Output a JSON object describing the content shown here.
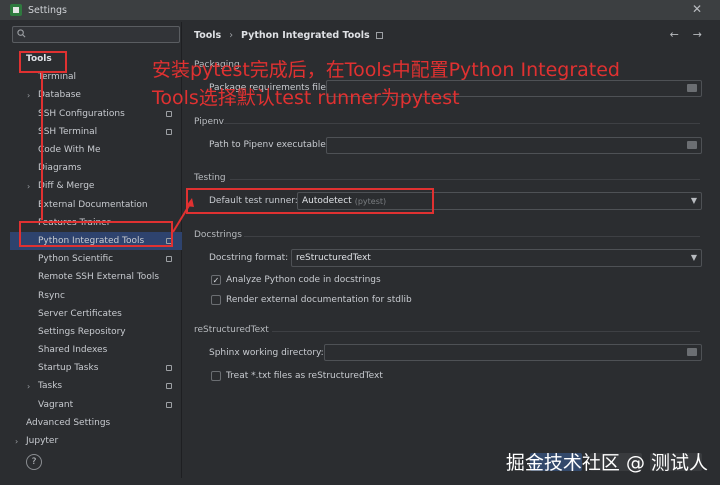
{
  "window": {
    "title": "Settings"
  },
  "search": {
    "placeholder": "Q"
  },
  "sidebar": {
    "items": [
      {
        "label": "Tools",
        "bold": true
      },
      {
        "label": "Terminal"
      },
      {
        "label": "Database",
        "expandable": true
      },
      {
        "label": "SSH Configurations",
        "configurable": true
      },
      {
        "label": "SSH Terminal",
        "configurable": true
      },
      {
        "label": "Code With Me"
      },
      {
        "label": "Diagrams"
      },
      {
        "label": "Diff & Merge",
        "expandable": true
      },
      {
        "label": "External Documentation"
      },
      {
        "label": "Features Trainer"
      },
      {
        "label": "Python Integrated Tools",
        "configurable": true,
        "selected": true
      },
      {
        "label": "Python Scientific",
        "configurable": true
      },
      {
        "label": "Remote SSH External Tools"
      },
      {
        "label": "Rsync"
      },
      {
        "label": "Server Certificates"
      },
      {
        "label": "Settings Repository"
      },
      {
        "label": "Shared Indexes"
      },
      {
        "label": "Startup Tasks",
        "configurable": true
      },
      {
        "label": "Tasks",
        "expandable": true,
        "configurable": true
      },
      {
        "label": "Vagrant",
        "configurable": true
      },
      {
        "label": "Advanced Settings"
      },
      {
        "label": "Jupyter",
        "expandable": true
      }
    ]
  },
  "breadcrumb": {
    "root": "Tools",
    "current": "Python Integrated Tools"
  },
  "packaging": {
    "title": "Packaging",
    "requirements_label": "Package requirements file:",
    "requirements_value": ""
  },
  "pipenv": {
    "title": "Pipenv",
    "path_label": "Path to Pipenv executable:",
    "path_value": ""
  },
  "testing": {
    "title": "Testing",
    "runner_label": "Default test runner:",
    "runner_value": "Autodetect",
    "runner_hint": "(pytest)"
  },
  "docstrings": {
    "title": "Docstrings",
    "format_label": "Docstring format:",
    "format_value": "reStructuredText",
    "analyze_label": "Analyze Python code in docstrings",
    "analyze_checked": true,
    "render_label": "Render external documentation for stdlib",
    "render_checked": false
  },
  "rest": {
    "title": "reStructuredText",
    "sphinx_label": "Sphinx working directory:",
    "sphinx_value": "",
    "txt_label": "Treat *.txt files as reStructuredText",
    "txt_checked": false
  },
  "annotation": {
    "text": "安装pytest完成后，在Tools中配置Python Integrated Tools选择默认test runner为pytest",
    "color": "#e03131"
  },
  "watermark": {
    "text": "掘金技术社区 @ 测试人"
  },
  "help": {
    "label": "?"
  }
}
